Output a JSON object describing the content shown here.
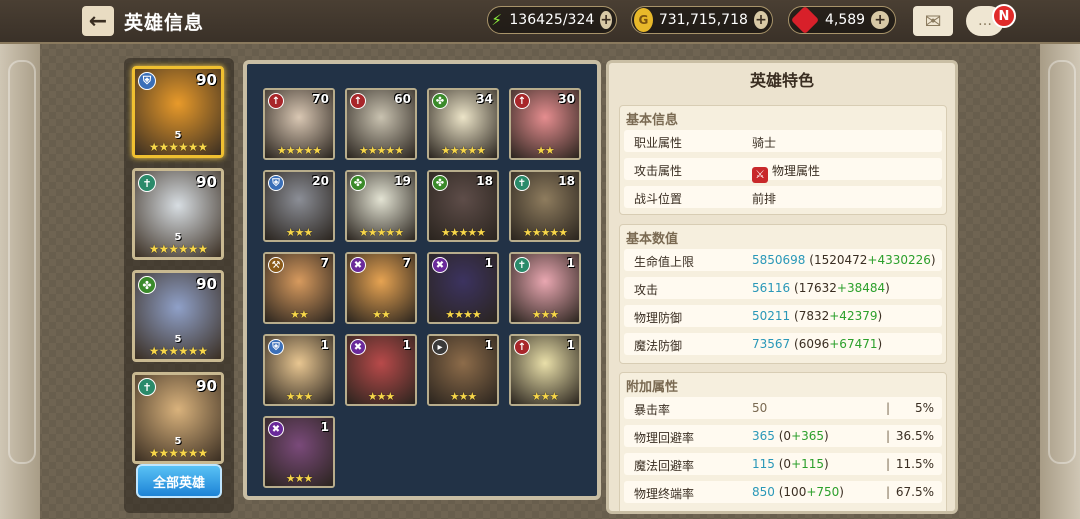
{
  "header": {
    "title": "英雄信息",
    "stamina": "136425/324",
    "gold": "731,715,718",
    "ruby": "4,589",
    "notification_badge": "N"
  },
  "roster": {
    "all_heroes_label": "全部英雄",
    "cards": [
      {
        "level": "90",
        "transcend": "5",
        "class_icon": "shield-icon",
        "color": "#e89a2a",
        "selected": true
      },
      {
        "level": "90",
        "transcend": "5",
        "class_icon": "cross-icon",
        "color": "#d7dde2"
      },
      {
        "level": "90",
        "transcend": "5",
        "class_icon": "arrow-icon",
        "color": "#8fa0c8"
      },
      {
        "level": "90",
        "transcend": "5",
        "class_icon": "cross-icon",
        "color": "#d9b27c"
      }
    ]
  },
  "grid": {
    "cards": [
      {
        "level": "70",
        "class_icon": "sword-icon",
        "stars": 5,
        "color": "#d9c7b3"
      },
      {
        "level": "60",
        "class_icon": "sword-icon",
        "stars": 5,
        "color": "#c9c2b0"
      },
      {
        "level": "34",
        "class_icon": "arrow-icon",
        "stars": 5,
        "color": "#ece4c8"
      },
      {
        "level": "30",
        "class_icon": "sword-icon",
        "stars": 2,
        "color": "#e58d8f"
      },
      {
        "level": "20",
        "class_icon": "shield-icon",
        "stars": 3,
        "color": "#8b8e96"
      },
      {
        "level": "19",
        "class_icon": "arrow-icon",
        "stars": 5,
        "color": "#e3e3d3"
      },
      {
        "level": "18",
        "class_icon": "arrow-icon",
        "stars": 5,
        "color": "#5e4d49"
      },
      {
        "level": "18",
        "class_icon": "cross-icon",
        "stars": 5,
        "color": "#8e7c5e"
      },
      {
        "level": "7",
        "class_icon": "axe-icon",
        "stars": 2,
        "color": "#d79a5e"
      },
      {
        "level": "7",
        "class_icon": "dagger-icon",
        "stars": 2,
        "color": "#e6a352"
      },
      {
        "level": "1",
        "class_icon": "dagger-icon",
        "stars": 4,
        "color": "#3c3360"
      },
      {
        "level": "1",
        "class_icon": "cross-icon",
        "stars": 3,
        "color": "#e9a7b1"
      },
      {
        "level": "1",
        "class_icon": "shield-icon",
        "stars": 3,
        "color": "#e8c691"
      },
      {
        "level": "1",
        "class_icon": "dagger-icon",
        "stars": 3,
        "color": "#b84a4a"
      },
      {
        "level": "1",
        "class_icon": "gun-icon",
        "stars": 3,
        "color": "#8d6c4a"
      },
      {
        "level": "1",
        "class_icon": "sword-icon",
        "stars": 3,
        "color": "#e9dfa9"
      },
      {
        "level": "1",
        "class_icon": "dagger-icon",
        "stars": 3,
        "color": "#7a4a7a"
      }
    ]
  },
  "detail": {
    "title": "英雄特色",
    "basic_info": {
      "head": "基本信息",
      "rows": [
        {
          "k": "职业属性",
          "v": "骑士"
        },
        {
          "k": "攻击属性",
          "v": "物理属性"
        },
        {
          "k": "战斗位置",
          "v": "前排"
        }
      ]
    },
    "basic_stats": {
      "head": "基本数值",
      "rows": [
        {
          "k": "生命值上限",
          "total": "5850698",
          "base": "1520472",
          "bonus": "+4330226"
        },
        {
          "k": "攻击",
          "total": "56116",
          "base": "17632",
          "bonus": "+38484"
        },
        {
          "k": "物理防御",
          "total": "50211",
          "base": "7832",
          "bonus": "+42379"
        },
        {
          "k": "魔法防御",
          "total": "73567",
          "base": "6096",
          "bonus": "+67471"
        }
      ]
    },
    "extra": {
      "head": "附加属性",
      "rows": [
        {
          "k": "暴击率",
          "total": "50",
          "pct": "5%"
        },
        {
          "k": "物理回避率",
          "total": "365",
          "base": "0",
          "bonus": "+365",
          "pct": "36.5%"
        },
        {
          "k": "魔法回避率",
          "total": "115",
          "base": "0",
          "bonus": "+115",
          "pct": "11.5%"
        },
        {
          "k": "物理终端率",
          "total": "850",
          "base": "100",
          "bonus": "+750",
          "pct": "67.5%"
        }
      ]
    }
  }
}
